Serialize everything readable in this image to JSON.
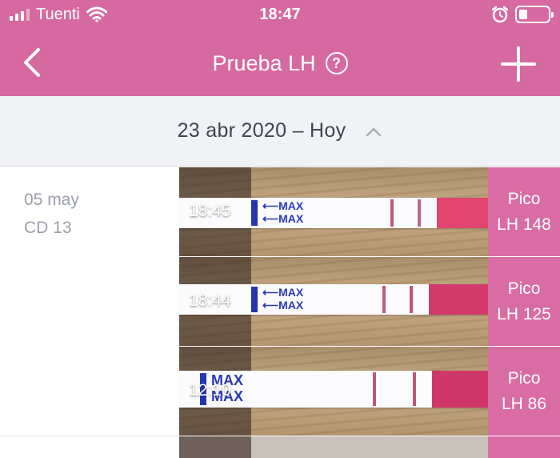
{
  "status_bar": {
    "carrier": "Tuenti",
    "time": "18:47",
    "icons": [
      "signal-icon",
      "wifi-icon",
      "alarm-icon",
      "battery-icon"
    ]
  },
  "nav": {
    "title": "Prueba LH",
    "help_symbol": "?",
    "icons": [
      "back-chevron-icon",
      "help-icon",
      "add-plus-icon"
    ]
  },
  "range": {
    "label": "23 abr 2020 – Hoy",
    "icon": "chevron-up-icon"
  },
  "day": {
    "date": "05 may",
    "cycle_day": "CD 13"
  },
  "tests": [
    {
      "time": "18:45",
      "result_label": "Pico",
      "result_value": "LH 148"
    },
    {
      "time": "18:44",
      "result_label": "Pico",
      "result_value": "LH 125"
    },
    {
      "time": "12:10",
      "result_label": "Pico",
      "result_value": "LH 86"
    }
  ],
  "strip_text": "MAX",
  "colors": {
    "brand_pink": "#d6699f",
    "result_pink": "#d96ca3",
    "range_bg": "#f1f2f6",
    "muted_text": "#9aa0ab"
  }
}
